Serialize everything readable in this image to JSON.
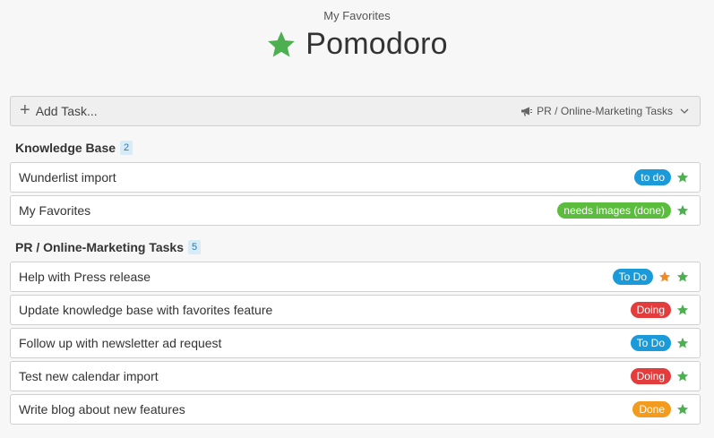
{
  "breadcrumb": "My Favorites",
  "title": "Pomodoro",
  "title_icon": "star-icon",
  "add_task": {
    "label": "Add Task...",
    "icon": "plus-icon"
  },
  "list_selector": {
    "label": "PR / Online-Marketing Tasks",
    "icon": "megaphone-icon"
  },
  "colors": {
    "star_green": "#4caf50",
    "star_orange": "#f08a24",
    "tag_blue": "#1a9ad9",
    "tag_green": "#5bbd3c",
    "tag_red": "#e23c3c",
    "tag_orange": "#f29b1d"
  },
  "sections": [
    {
      "title": "Knowledge Base",
      "count": "2",
      "tasks": [
        {
          "name": "Wunderlist import",
          "tag": "to do",
          "tag_color": "#1a9ad9",
          "extra_star": false
        },
        {
          "name": "My Favorites",
          "tag": "needs images (done)",
          "tag_color": "#5bbd3c",
          "extra_star": false
        }
      ]
    },
    {
      "title": "PR / Online-Marketing Tasks",
      "count": "5",
      "tasks": [
        {
          "name": "Help with Press release",
          "tag": "To Do",
          "tag_color": "#1a9ad9",
          "extra_star": true
        },
        {
          "name": "Update knowledge base with favorites feature",
          "tag": "Doing",
          "tag_color": "#e23c3c",
          "extra_star": false
        },
        {
          "name": "Follow up with newsletter ad request",
          "tag": "To Do",
          "tag_color": "#1a9ad9",
          "extra_star": false
        },
        {
          "name": "Test new calendar import",
          "tag": "Doing",
          "tag_color": "#e23c3c",
          "extra_star": false
        },
        {
          "name": "Write blog about new features",
          "tag": "Done",
          "tag_color": "#f29b1d",
          "extra_star": false
        }
      ]
    }
  ]
}
